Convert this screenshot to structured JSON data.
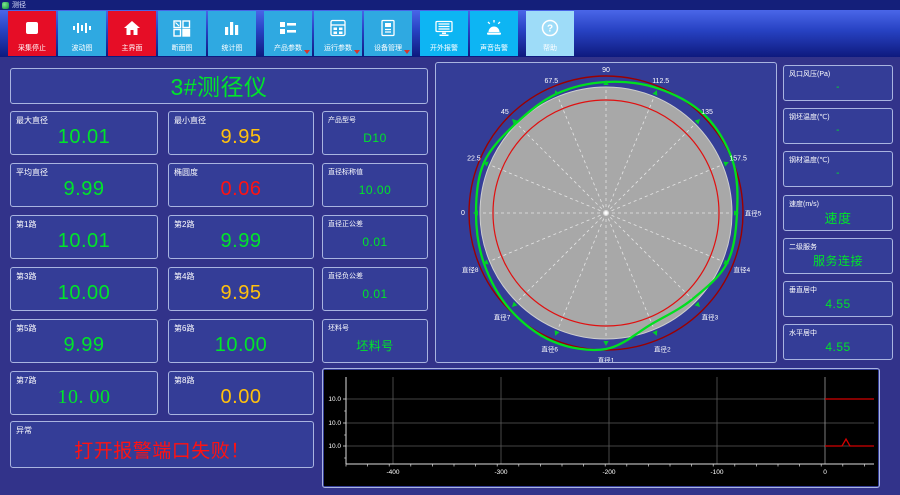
{
  "window": {
    "title": "测径"
  },
  "toolbar": {
    "buttons": [
      {
        "label": "采集停止",
        "icon": "stop-icon"
      },
      {
        "label": "波动图",
        "icon": "waveform-icon"
      },
      {
        "label": "主界面",
        "icon": "home-icon"
      },
      {
        "label": "断面图",
        "icon": "section-view-icon"
      },
      {
        "label": "统计图",
        "icon": "statistics-icon"
      },
      {
        "label": "产品参数",
        "icon": "product-params-icon",
        "dropdown": true
      },
      {
        "label": "运行参数",
        "icon": "run-params-icon",
        "dropdown": true
      },
      {
        "label": "设备管理",
        "icon": "device-manage-icon",
        "dropdown": true
      },
      {
        "label": "开外报警",
        "icon": "external-alarm-icon"
      },
      {
        "label": "声音告警",
        "icon": "sound-alarm-icon"
      },
      {
        "label": "帮助",
        "icon": "help-icon"
      }
    ]
  },
  "left_panel": {
    "title": "3#测径仪",
    "title_color": "#00e52a",
    "boxes": [
      {
        "label": "最大直径",
        "value": "10.01",
        "color": "#00e52a"
      },
      {
        "label": "最小直径",
        "value": "9.95",
        "color": "#ffc10e"
      },
      {
        "label": "产品型号",
        "value": "D10",
        "color": "#00e52a"
      },
      {
        "label": "平均直径",
        "value": "9.99",
        "color": "#00e52a"
      },
      {
        "label": "椭圆度",
        "value": "0.06",
        "color": "#ff1212"
      },
      {
        "label": "直径标称值",
        "value": "10.00",
        "color": "#00e52a"
      },
      {
        "label": "第1路",
        "value": "10.01",
        "color": "#00e52a"
      },
      {
        "label": "第2路",
        "value": "9.99",
        "color": "#00e52a"
      },
      {
        "label": "直径正公差",
        "value": "0.01",
        "color": "#00e52a"
      },
      {
        "label": "第3路",
        "value": "10.00",
        "color": "#00e52a"
      },
      {
        "label": "第4路",
        "value": "9.95",
        "color": "#ffc10e"
      },
      {
        "label": "直径负公差",
        "value": "0.01",
        "color": "#00e52a"
      },
      {
        "label": "第5路",
        "value": "9.99",
        "color": "#00e52a"
      },
      {
        "label": "第6路",
        "value": "10.00",
        "color": "#00e52a"
      },
      {
        "label": "坯料号",
        "value": "坯料号",
        "color": "#00e52a"
      },
      {
        "label": "第7路",
        "value": "10. 00",
        "color": "#00e52a"
      },
      {
        "label": "第8路",
        "value": "0.00",
        "color": "#ffc10e"
      },
      {
        "label": "异常",
        "value": "打开报警端口失败！",
        "color": "#ff1212"
      }
    ]
  },
  "right_panel": {
    "boxes": [
      {
        "label": "风口风压(Pa)",
        "value": "-",
        "color": "#00e52a"
      },
      {
        "label": "钢坯温度(℃)",
        "value": "-",
        "color": "#00e52a"
      },
      {
        "label": "钢材温度(℃)",
        "value": "-",
        "color": "#00e52a"
      },
      {
        "label": "速度(m/s)",
        "value": "速度",
        "color": "#00e52a"
      },
      {
        "label": "二级服务",
        "value": "服务连接",
        "color": "#00e52a"
      },
      {
        "label": "垂直居中",
        "value": "4.55",
        "color": "#00e52a"
      },
      {
        "label": "水平居中",
        "value": "4.55",
        "color": "#00e52a"
      }
    ]
  },
  "polar": {
    "angle_labels": [
      "0",
      "22.5",
      "45",
      "67.5",
      "90",
      "112.5",
      "135",
      "157.5"
    ],
    "diameter_labels": [
      "直径5",
      "直径4",
      "直径3",
      "直径2",
      "直径1",
      "直径6",
      "直径7",
      "直径8"
    ],
    "profile_radii": [
      131,
      137,
      139,
      135,
      131,
      129,
      127,
      132,
      130,
      132,
      136,
      139,
      136,
      120,
      122,
      131
    ],
    "radii": {
      "disc": 126,
      "outer": 137,
      "inner": 113
    },
    "colors": {
      "disc": "#a8a8a8",
      "outer_circle": "#9b0000",
      "inner_circle": "#e01010",
      "profile": "#00e020",
      "rays": "#ececec",
      "marker": "#00d02a"
    }
  },
  "trend": {
    "y_labels": [
      "10.0",
      "10.0",
      "10.0"
    ],
    "x_labels": [
      "-400",
      "-300",
      "-200",
      "-100",
      "0"
    ],
    "red_traces": [
      {
        "gridline": 0,
        "spike": false
      },
      {
        "gridline": 2,
        "spike": true
      }
    ],
    "colors": {
      "bg": "#000000",
      "axis": "#dddddd",
      "grid": "#5a5a5a",
      "zero_line": "#9a9a9a",
      "trace": "#d40000",
      "text": "#ffffff"
    }
  }
}
